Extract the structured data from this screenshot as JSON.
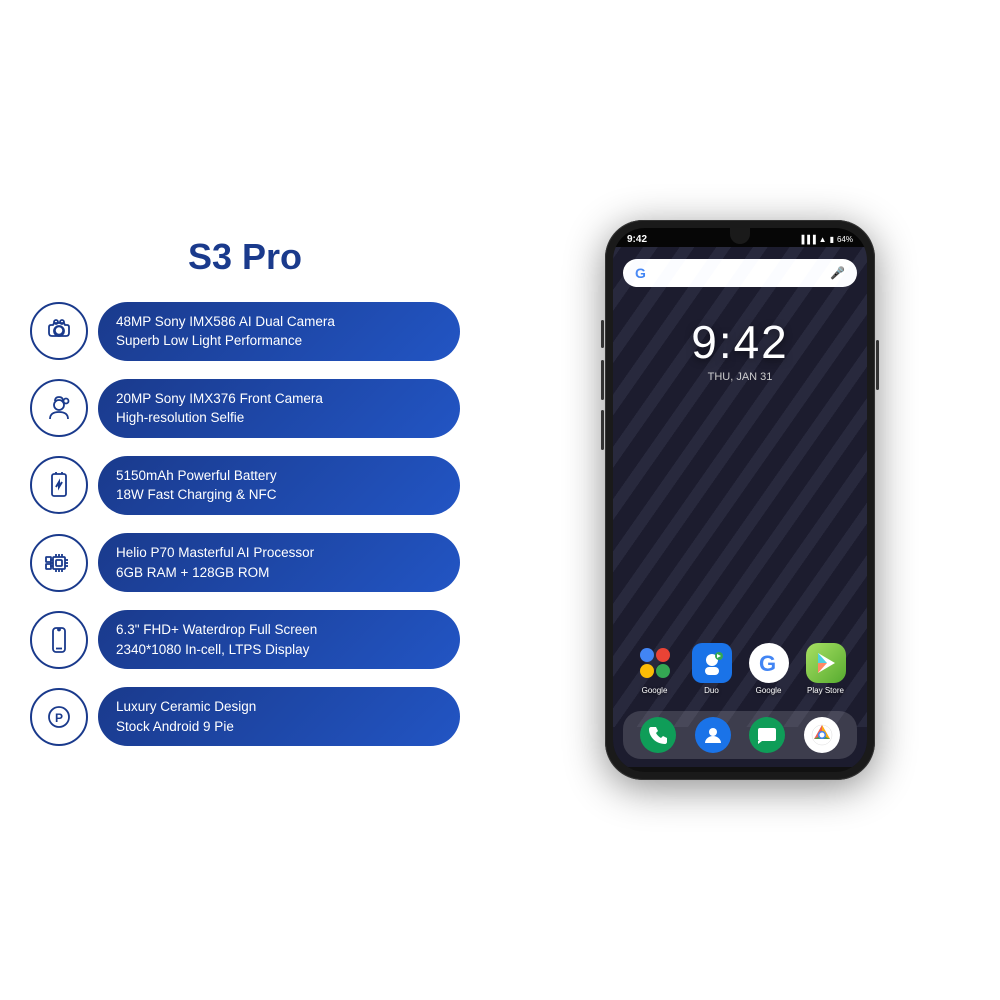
{
  "product": {
    "title": "S3 Pro"
  },
  "features": [
    {
      "id": "camera",
      "icon": "camera",
      "line1": "48MP Sony IMX586 AI Dual Camera",
      "line2": "Superb Low Light Performance"
    },
    {
      "id": "selfie",
      "icon": "selfie",
      "line1": "20MP Sony IMX376 Front Camera",
      "line2": "High-resolution Selfie"
    },
    {
      "id": "battery",
      "icon": "battery",
      "line1": "5150mAh Powerful Battery",
      "line2": "18W Fast Charging & NFC"
    },
    {
      "id": "processor",
      "icon": "cpu",
      "line1": "Helio P70 Masterful AI Processor",
      "line2": "6GB RAM + 128GB ROM"
    },
    {
      "id": "display",
      "icon": "display",
      "line1": "6.3\" FHD+ Waterdrop Full Screen",
      "line2": "2340*1080 In-cell, LTPS Display"
    },
    {
      "id": "android",
      "icon": "android",
      "line1": "Luxury Ceramic Design",
      "line2": "Stock Android 9 Pie"
    }
  ],
  "phone": {
    "status_time": "9:42",
    "status_battery": "64%",
    "clock_time": "9:42",
    "clock_date": "THU, JAN 31",
    "apps": [
      {
        "label": "Google",
        "color": "#fff"
      },
      {
        "label": "Duo",
        "color": "#1a73e8"
      },
      {
        "label": "Google",
        "color": "#fff"
      },
      {
        "label": "Play Store",
        "color": "#fff"
      }
    ],
    "dock_apps": [
      {
        "label": "Phone"
      },
      {
        "label": "Contacts"
      },
      {
        "label": "Messages"
      },
      {
        "label": "Chrome"
      }
    ]
  }
}
